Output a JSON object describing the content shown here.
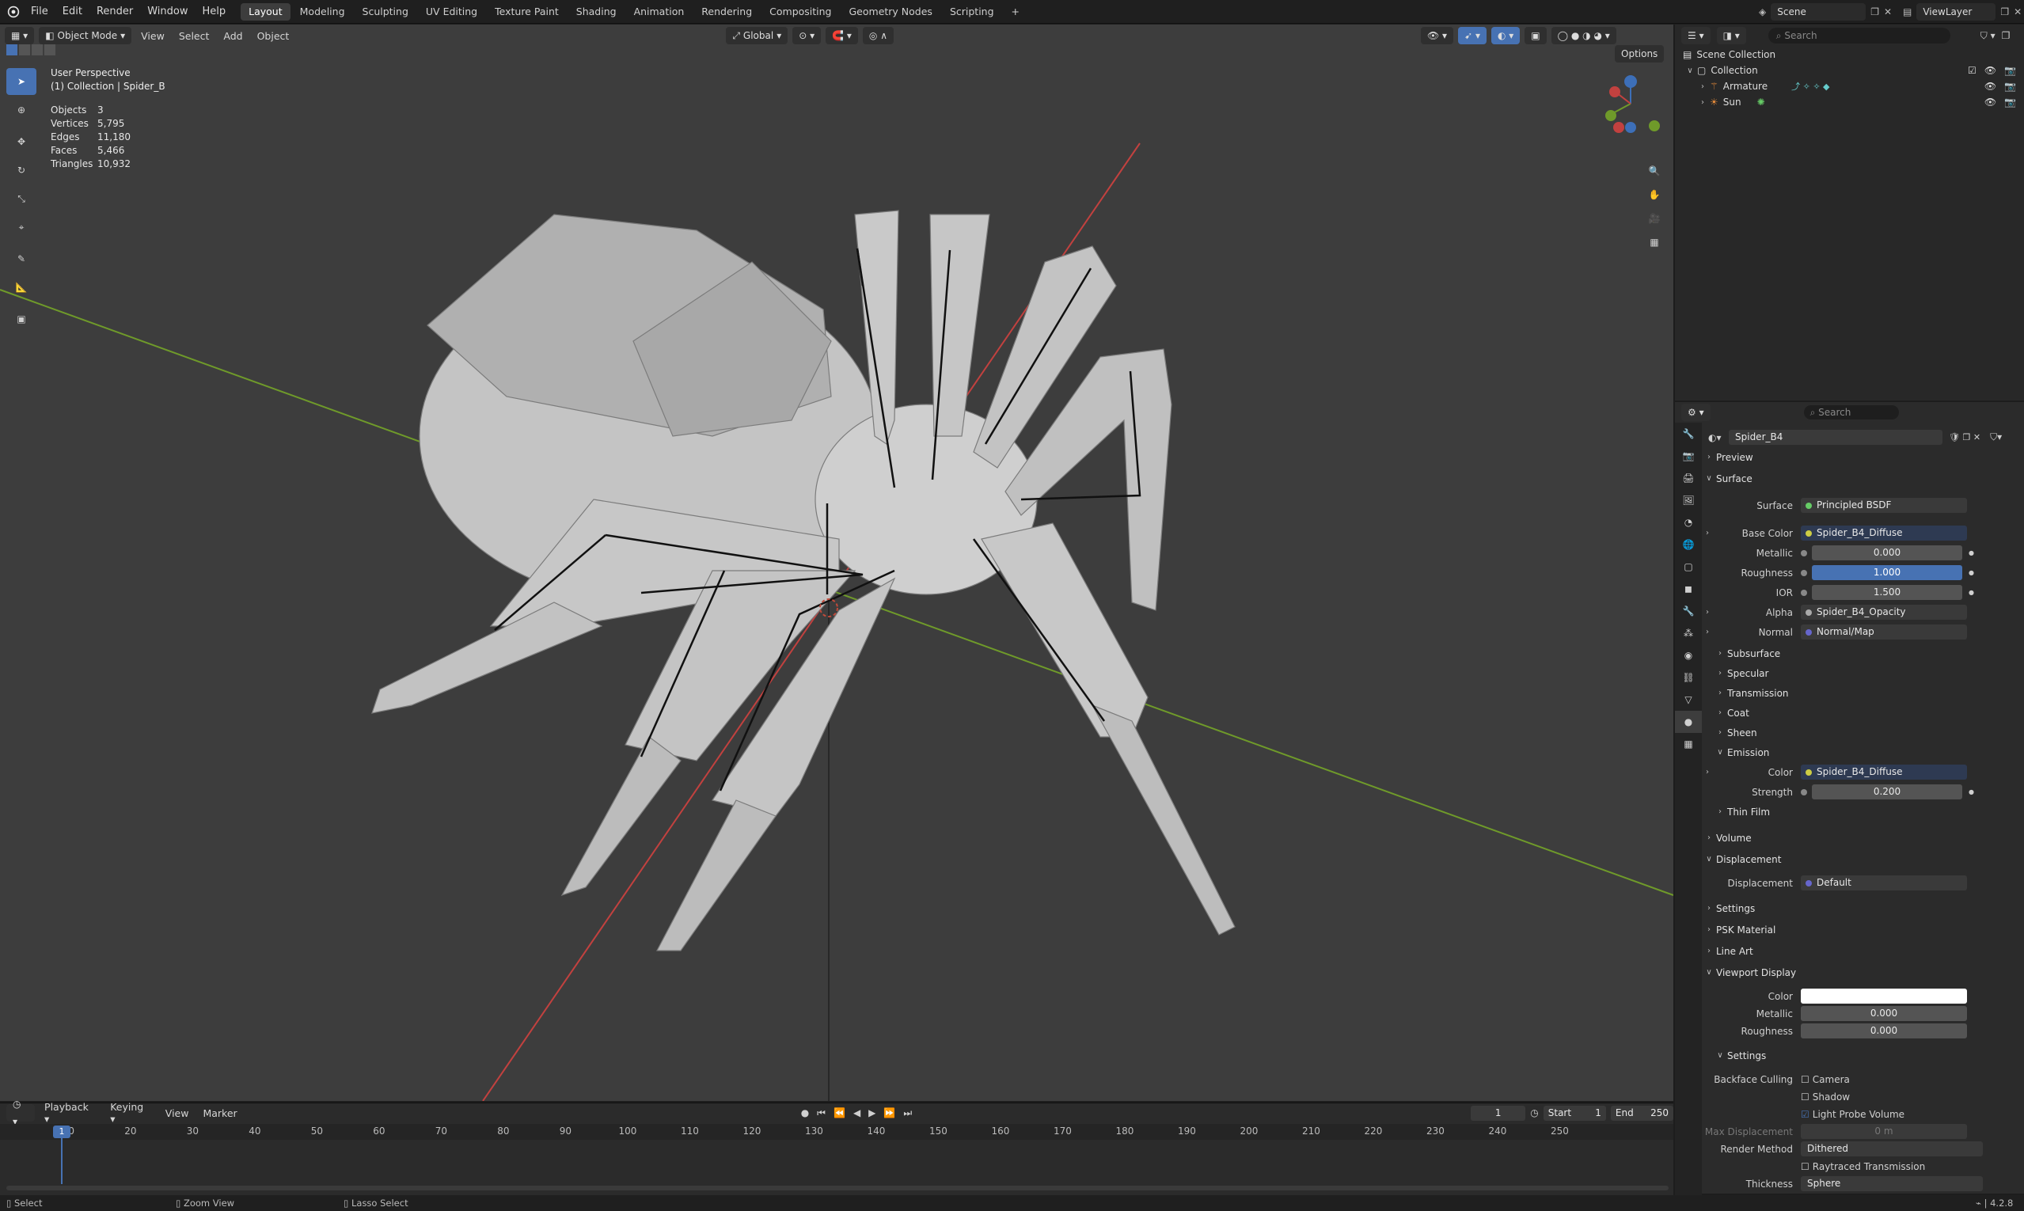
{
  "menu": [
    "File",
    "Edit",
    "Render",
    "Window",
    "Help"
  ],
  "workspaces": [
    "Layout",
    "Modeling",
    "Sculpting",
    "UV Editing",
    "Texture Paint",
    "Shading",
    "Animation",
    "Rendering",
    "Compositing",
    "Geometry Nodes",
    "Scripting"
  ],
  "active_workspace": "Layout",
  "scene_name": "Scene",
  "view_layer": "ViewLayer",
  "viewport": {
    "mode": "Object Mode",
    "menus": [
      "View",
      "Select",
      "Add",
      "Object"
    ],
    "transform_orientation": "Global",
    "options_label": "Options",
    "perspective": "User Perspective",
    "collection_info": "(1) Collection | Spider_B",
    "stats": [
      {
        "k": "Objects",
        "v": "3"
      },
      {
        "k": "Vertices",
        "v": "5,795"
      },
      {
        "k": "Edges",
        "v": "11,180"
      },
      {
        "k": "Faces",
        "v": "5,466"
      },
      {
        "k": "Triangles",
        "v": "10,932"
      }
    ],
    "gizmo": {
      "z": "Z",
      "y": "Y",
      "x": "X"
    }
  },
  "outliner": {
    "search_placeholder": "Search",
    "scene_collection": "Scene Collection",
    "collection": "Collection",
    "items": [
      "Armature",
      "Sun"
    ]
  },
  "properties": {
    "search_placeholder": "Search",
    "material_name": "Spider_B4",
    "sections": {
      "preview": "Preview",
      "surface": "Surface",
      "subsurface": "Subsurface",
      "specular": "Specular",
      "transmission": "Transmission",
      "coat": "Coat",
      "sheen": "Sheen",
      "emission": "Emission",
      "thin_film": "Thin Film",
      "volume": "Volume",
      "displacement": "Displacement",
      "settings": "Settings",
      "psk_material": "PSK Material",
      "line_art": "Line Art",
      "viewport_display": "Viewport Display",
      "vd_settings": "Settings"
    },
    "surface": {
      "surface_label": "Surface",
      "surface_value": "Principled BSDF",
      "base_color_label": "Base Color",
      "base_color_value": "Spider_B4_Diffuse",
      "metallic_label": "Metallic",
      "metallic_value": "0.000",
      "roughness_label": "Roughness",
      "roughness_value": "1.000",
      "ior_label": "IOR",
      "ior_value": "1.500",
      "alpha_label": "Alpha",
      "alpha_value": "Spider_B4_Opacity",
      "normal_label": "Normal",
      "normal_value": "Normal/Map"
    },
    "emission": {
      "color_label": "Color",
      "color_value": "Spider_B4_Diffuse",
      "strength_label": "Strength",
      "strength_value": "0.200"
    },
    "displacement": {
      "label": "Displacement",
      "value": "Default"
    },
    "viewport_display": {
      "color_label": "Color",
      "metallic_label": "Metallic",
      "metallic_value": "0.000",
      "roughness_label": "Roughness",
      "roughness_value": "0.000",
      "backface_label": "Backface Culling",
      "camera": "Camera",
      "shadow": "Shadow",
      "light_probe": "Light Probe Volume",
      "max_disp_label": "Max Displacement",
      "max_disp_value": "0 m",
      "render_method_label": "Render Method",
      "render_method_value": "Dithered",
      "raytraced": "Raytraced Transmission",
      "thickness_label": "Thickness",
      "thickness_value": "Sphere"
    }
  },
  "timeline": {
    "menus": [
      "Playback",
      "Keying",
      "View",
      "Marker"
    ],
    "current_frame": "1",
    "start_label": "Start",
    "start_value": "1",
    "end_label": "End",
    "end_value": "250",
    "ruler": [
      "1",
      "10",
      "20",
      "30",
      "40",
      "50",
      "60",
      "70",
      "80",
      "90",
      "100",
      "110",
      "120",
      "130",
      "140",
      "150",
      "160",
      "170",
      "180",
      "190",
      "200",
      "210",
      "220",
      "230",
      "240",
      "250"
    ]
  },
  "statusbar": {
    "select": "Select",
    "zoom_view": "Zoom View",
    "lasso_select": "Lasso Select",
    "version": "4.2.8"
  },
  "colors": {
    "accent": "#4772b3",
    "viewport_bg": "#3d3d3d",
    "x_axis": "#c2413f",
    "y_axis": "#6f9a2a"
  }
}
